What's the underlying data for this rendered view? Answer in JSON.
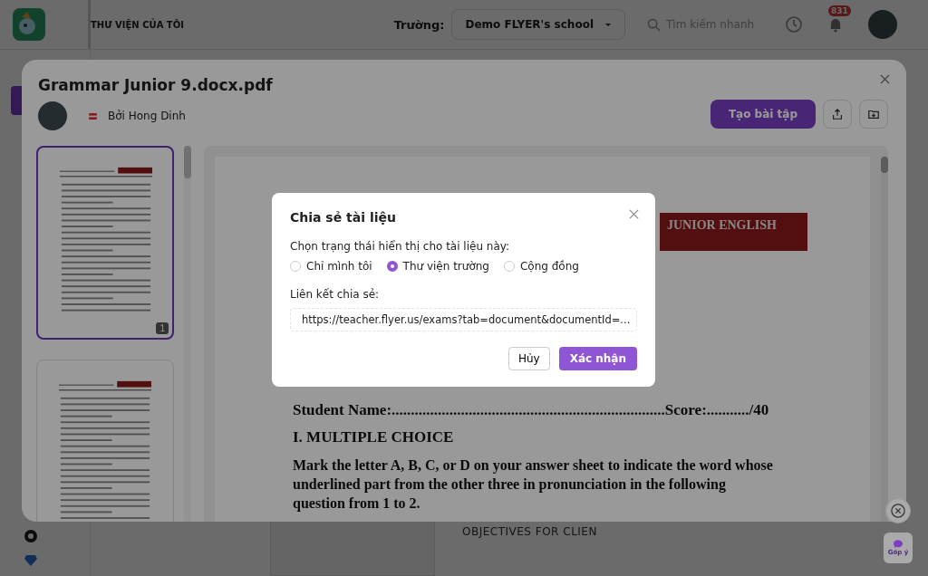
{
  "topbar": {
    "title": "THƯ VIỆN CỦA TÔI",
    "school_label": "Trường:",
    "school": "Demo FLYER's school",
    "search": {
      "placeholder": "Tìm kiếm nhanh"
    },
    "notifications": "831"
  },
  "background": {
    "heading": "OBJECTIVES FOR CLIEN"
  },
  "document": {
    "title": "Grammar Junior 9.docx.pdf",
    "author": "Bởi Hong Dinh",
    "create_button": "Tạo bài tập",
    "thumbnails": [
      {
        "page": "1",
        "selected": true
      },
      {
        "selected": false
      }
    ],
    "page": {
      "banner": "JUNIOR ENGLISH",
      "student_name": "Student Name:.......................................................................",
      "score": "Score:.........../40",
      "section": "I. MULTIPLE CHOICE",
      "instruction": "Mark the letter A, B, C, or D on your answer sheet to indicate the word whose underlined part from the other three in pronunciation in the following question from 1 to 2."
    }
  },
  "dialog": {
    "title": "Chia sẻ tài liệu",
    "prompt": "Chọn trạng thái hiển thị cho tài liệu này:",
    "options": [
      {
        "label": "Chỉ mình tôi",
        "selected": false
      },
      {
        "label": "Thư viện trường",
        "selected": true
      },
      {
        "label": "Cộng đồng",
        "selected": false
      }
    ],
    "link_label": "Liên kết chia sẻ:",
    "link": "https://teacher.flyer.us/exams?tab=document&documentId=...",
    "cancel": "Hủy",
    "confirm": "Xác nhận"
  },
  "feedback": "Góp ý"
}
